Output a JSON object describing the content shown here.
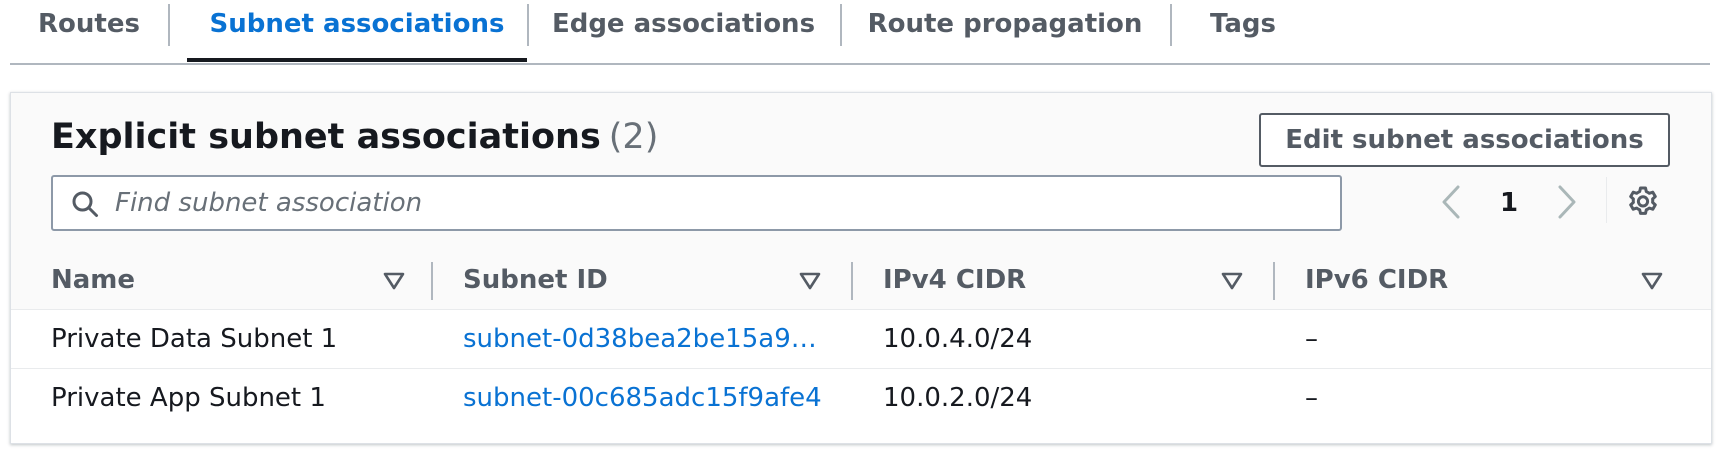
{
  "tabs": [
    {
      "label": "Routes",
      "active": false
    },
    {
      "label": "Subnet associations",
      "active": true
    },
    {
      "label": "Edge associations",
      "active": false
    },
    {
      "label": "Route propagation",
      "active": false
    },
    {
      "label": "Tags",
      "active": false
    }
  ],
  "panel": {
    "title": "Explicit subnet associations",
    "count": "(2)",
    "edit_button_label": "Edit subnet associations",
    "search_placeholder": "Find subnet association",
    "search_value": "",
    "current_page": "1"
  },
  "table": {
    "columns": [
      "Name",
      "Subnet ID",
      "IPv4 CIDR",
      "IPv6 CIDR"
    ],
    "rows": [
      {
        "name": "Private Data Subnet 1",
        "subnet_id": "subnet-0d38bea2be15a9…",
        "ipv4": "10.0.4.0/24",
        "ipv6": "–"
      },
      {
        "name": "Private App Subnet 1",
        "subnet_id": "subnet-00c685adc15f9afe4",
        "ipv4": "10.0.2.0/24",
        "ipv6": "–"
      }
    ]
  },
  "colors": {
    "accent": "#0972d3",
    "text": "#16191f",
    "muted": "#545b64",
    "border": "#b0b7bf"
  },
  "icons": [
    "search-icon",
    "chevron-left-icon",
    "chevron-right-icon",
    "gear-icon",
    "sort-caret-down-icon"
  ]
}
